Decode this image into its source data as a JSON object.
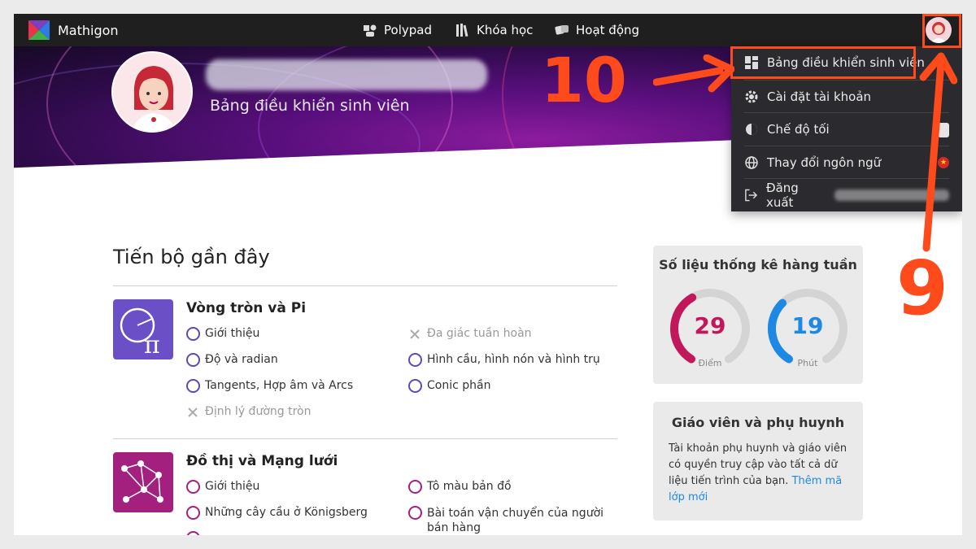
{
  "nav": {
    "brand": "Mathigon",
    "links": [
      {
        "label": "Polypad",
        "icon": "polypad-icon"
      },
      {
        "label": "Khóa học",
        "icon": "books-icon"
      },
      {
        "label": "Hoạt động",
        "icon": "dice-icon"
      }
    ]
  },
  "banner": {
    "subtitle": "Bảng điều khiển sinh viên"
  },
  "menu": {
    "items": [
      {
        "label": "Bảng điều khiển sinh viên",
        "icon": "dashboard-icon"
      },
      {
        "label": "Cài đặt tài khoản",
        "icon": "gear-icon"
      },
      {
        "label": "Chế độ tối",
        "icon": "dark-mode-icon"
      },
      {
        "label": "Thay đổi ngôn ngữ",
        "icon": "globe-icon"
      },
      {
        "label": "Đăng xuất",
        "icon": "logout-icon"
      }
    ]
  },
  "annotations": {
    "step_10": "10",
    "step_9": "9",
    "color": "#ff4a1c"
  },
  "recent": {
    "title": "Tiến bộ gần đây",
    "courses": [
      {
        "name": "Vòng tròn và Pi",
        "color": "#6a4fc6",
        "lessons": [
          {
            "label": "Giới thiệu",
            "state": "open"
          },
          {
            "label": "Độ và radian",
            "state": "open"
          },
          {
            "label": "Tangents, Hợp âm và Arcs",
            "state": "open"
          },
          {
            "label": "Định lý đường tròn",
            "state": "tool"
          },
          {
            "label": "Đa giác tuần hoàn",
            "state": "tool"
          },
          {
            "label": "Hình cầu, hình nón và hình trụ",
            "state": "open"
          },
          {
            "label": "Conic phần",
            "state": "open"
          }
        ]
      },
      {
        "name": "Đồ thị và Mạng lưới",
        "color": "#a3207f",
        "lessons": [
          {
            "label": "Giới thiệu",
            "state": "open"
          },
          {
            "label": "Những cây cầu ở Königsberg",
            "state": "open"
          },
          {
            "label": "Tô màu bản đồ",
            "state": "open"
          },
          {
            "label": "Bài toán vận chuyển của người bán hàng",
            "state": "open"
          }
        ]
      }
    ]
  },
  "stats": {
    "title": "Số liệu thống kê hàng tuần",
    "points": {
      "value": "29",
      "label": "Điểm",
      "color": "#c2185b",
      "fraction": 0.4
    },
    "minutes": {
      "value": "19",
      "label": "Phút",
      "color": "#1e88e5",
      "fraction": 0.35
    }
  },
  "teachers": {
    "title": "Giáo viên và phụ huynh",
    "body": "Tài khoản phụ huynh và giáo viên có quyền truy cập vào tất cả dữ liệu tiến trình của bạn.",
    "link": "Thêm mã lớp mới"
  }
}
